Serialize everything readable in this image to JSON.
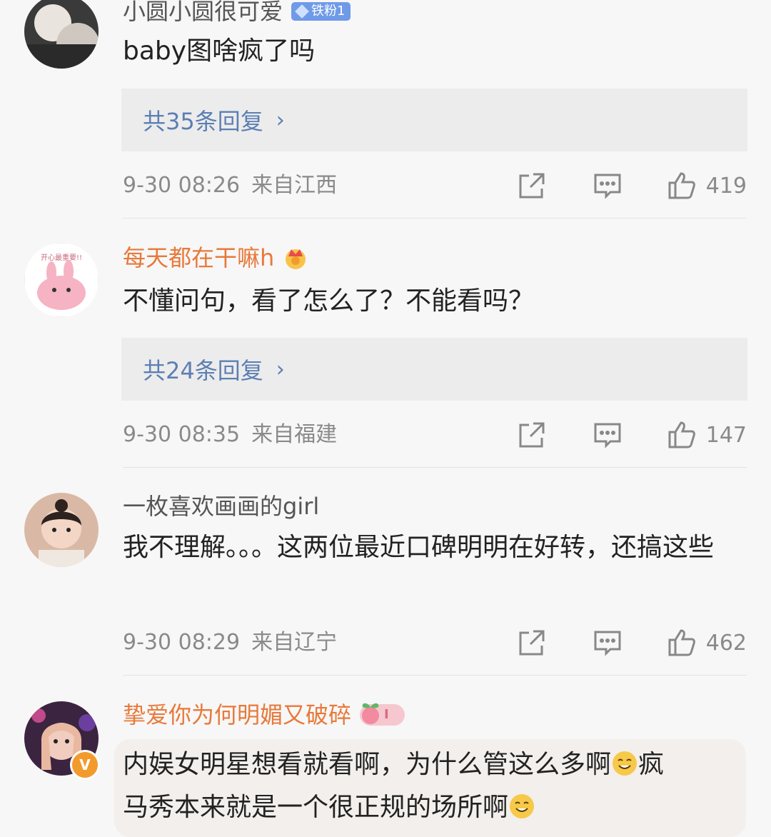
{
  "comments": [
    {
      "username": "小圆小圆很可爱",
      "badge": "铁粉1",
      "text": "baby图啥疯了吗",
      "replies": "共35条回复",
      "time": "9-30 08:26",
      "location": "来自江西",
      "likes": "419"
    },
    {
      "username": "每天都在干嘛h",
      "text": "不懂问句，看了怎么了？不能看吗？",
      "replies": "共24条回复",
      "time": "9-30 08:35",
      "location": "来自福建",
      "likes": "147",
      "avatar_text": "开心最重要!!"
    },
    {
      "username": "一枚喜欢画画的girl",
      "text": "我不理解。。。这两位最近口碑明明在好转，还搞这些",
      "time": "9-30 08:29",
      "location": "来自辽宁",
      "likes": "462"
    },
    {
      "username": "挚爱你为何明媚又破碎",
      "badge": "I",
      "text_line1": "内娱女明星想看就看啊，为什么管这么多啊",
      "text_line1_tail": "疯",
      "text_line2": "马秀本来就是一个很正规的场所啊"
    }
  ],
  "colors": {
    "link": "#5c7fb3",
    "orange_name": "#e8793a",
    "meta": "#8a8a8a"
  },
  "icons": [
    "share-icon",
    "comment-icon",
    "like-icon",
    "chevron-right-icon",
    "crown-icon",
    "verified-icon",
    "smile-emoji-icon"
  ]
}
